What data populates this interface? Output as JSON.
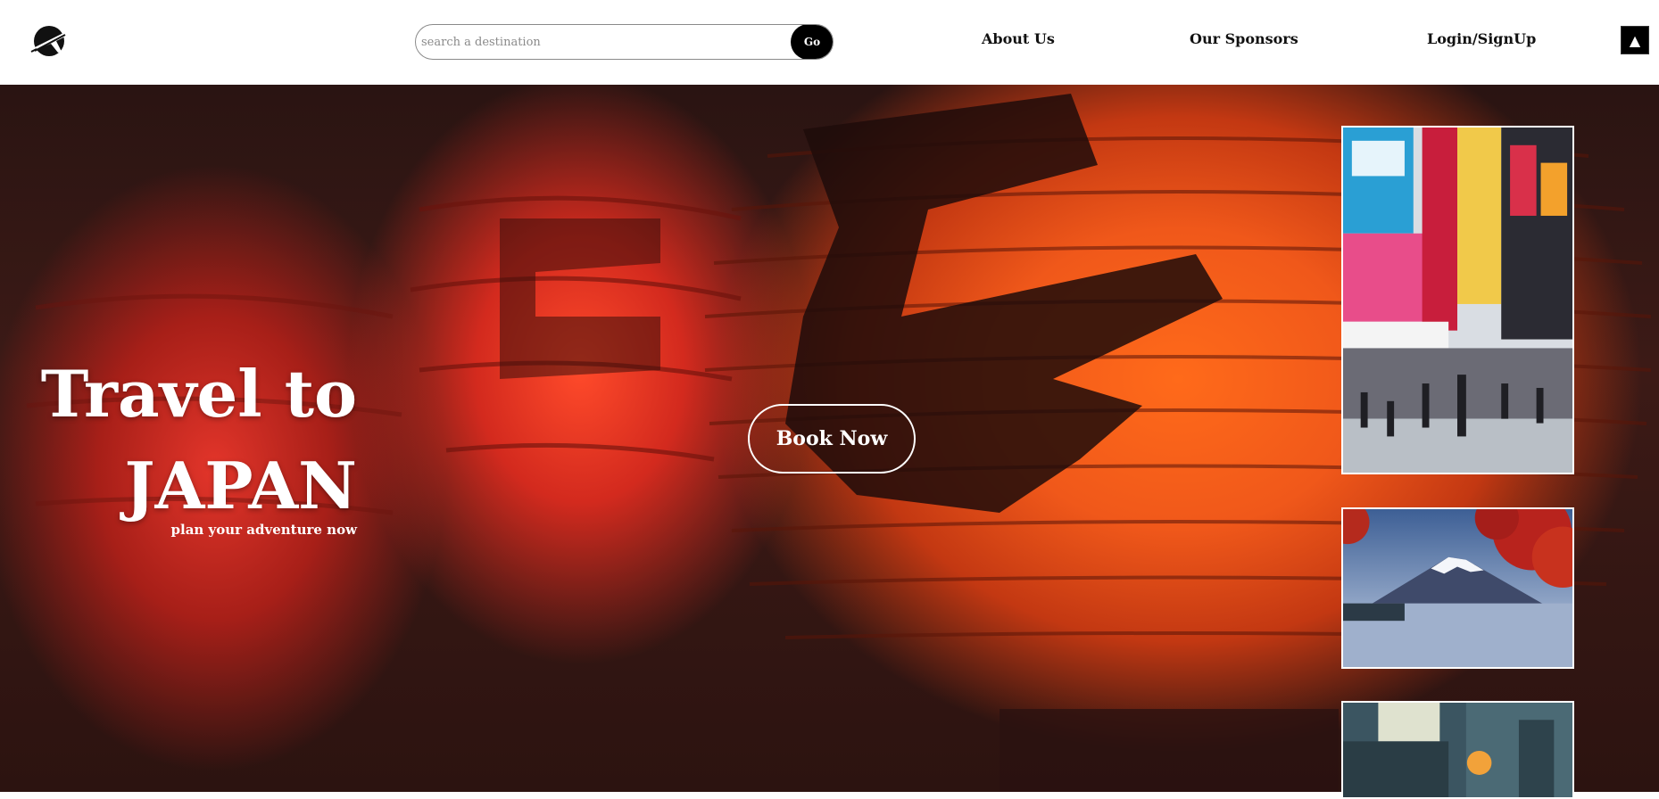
{
  "header": {
    "logo_icon": "plane-globe-icon",
    "search": {
      "placeholder": "search a destination",
      "value": "",
      "go_label": "Go"
    },
    "nav": {
      "about": "About Us",
      "sponsors": "Our Sponsors",
      "login": "Login/SignUp"
    },
    "scroll_top_icon": "▲"
  },
  "hero": {
    "title_line1": "Travel to",
    "title_line2": "JAPAN",
    "subtitle": "plan your adventure now",
    "book_label": "Book Now",
    "thumbnails": [
      {
        "name": "tokyo-street-photo"
      },
      {
        "name": "mount-fuji-photo"
      },
      {
        "name": "alley-lanterns-photo"
      }
    ]
  },
  "colors": {
    "accent": "#000000",
    "lantern": "#f0581a",
    "text_light": "#ffffff"
  }
}
